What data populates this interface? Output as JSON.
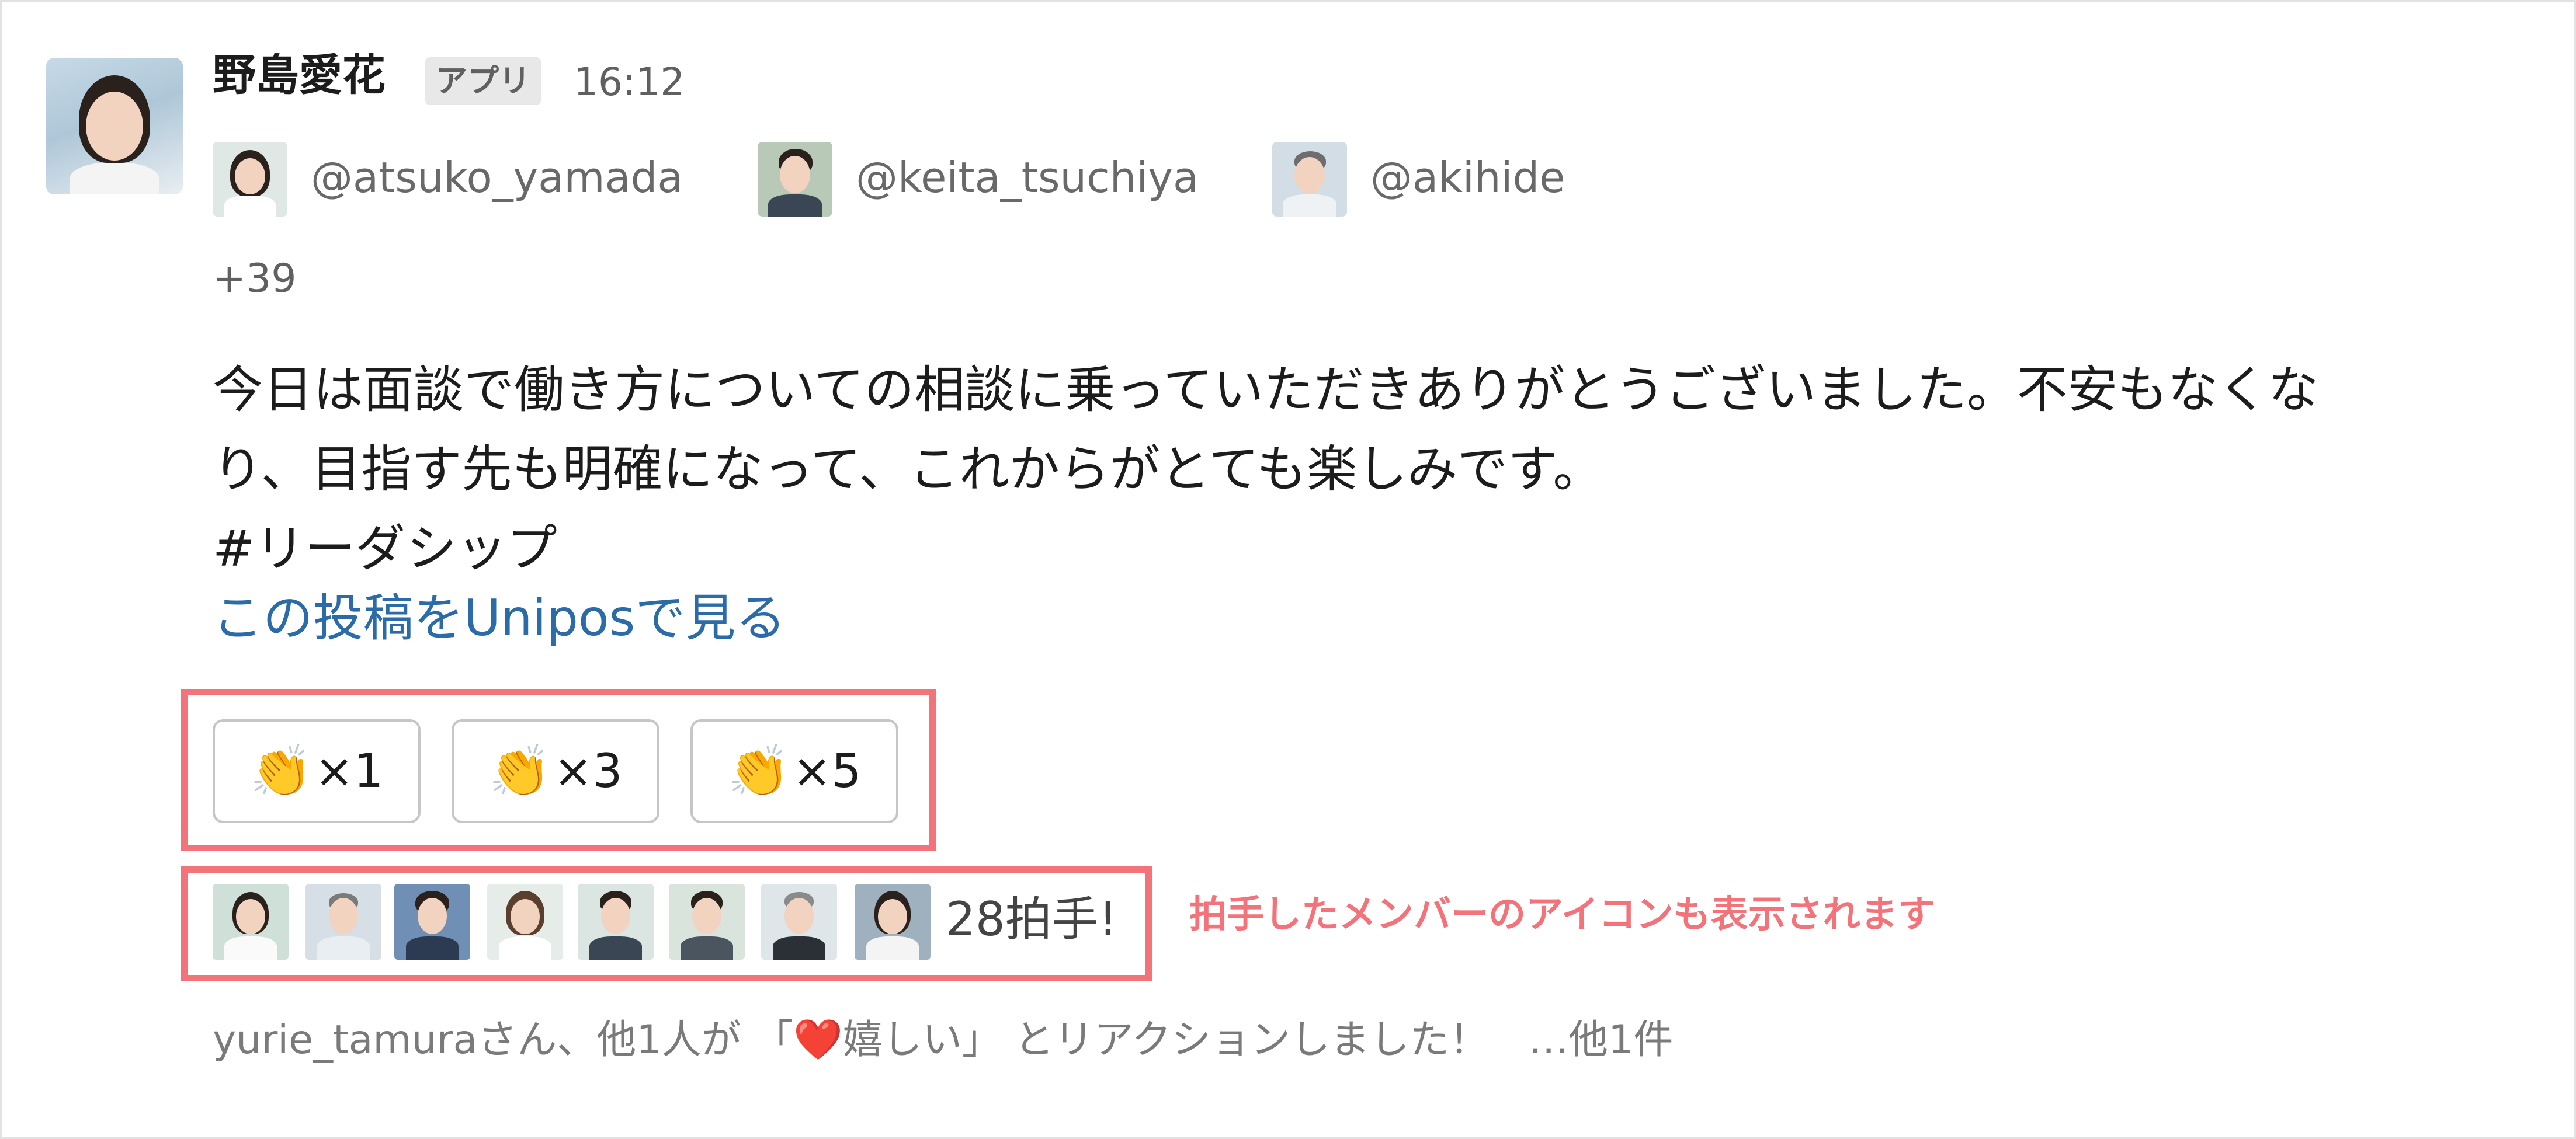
{
  "message": {
    "sender_name": "野島愛花",
    "app_badge": "アプリ",
    "time": "16:12",
    "mentions": [
      {
        "handle": "@atsuko_yamada",
        "avatar_icon": "avatar-woman-glasses-icon"
      },
      {
        "handle": "@keita_tsuchiya",
        "avatar_icon": "avatar-man-icon"
      },
      {
        "handle": "@akihide",
        "avatar_icon": "avatar-man-glasses-icon"
      }
    ],
    "more_recipients": "+39",
    "text_line1": "今日は面談で働き方についての相談に乗っていただきありがとうございました。不安もなくな",
    "text_line2": "り、目指す先も明確になって、これからがとても楽しみです。",
    "hashtag": "#リーダシップ",
    "link_text": "この投稿をUniposで見る"
  },
  "clap_buttons": [
    {
      "emoji": "👏",
      "label": "×1"
    },
    {
      "emoji": "👏",
      "label": "×3"
    },
    {
      "emoji": "👏",
      "label": "×5"
    }
  ],
  "clappers": {
    "count_text": "28拍手!",
    "annotation": "拍手したメンバーのアイコンも表示されます"
  },
  "reaction_summary": {
    "before": "yurie_tamuraさん、他1人が 「",
    "emoji": "❤️",
    "after": "嬉しい」 とリアクションしました！　…他1件"
  },
  "colors": {
    "highlight": "#f2747a",
    "link": "#2a6ba8",
    "muted_text": "#616061"
  }
}
